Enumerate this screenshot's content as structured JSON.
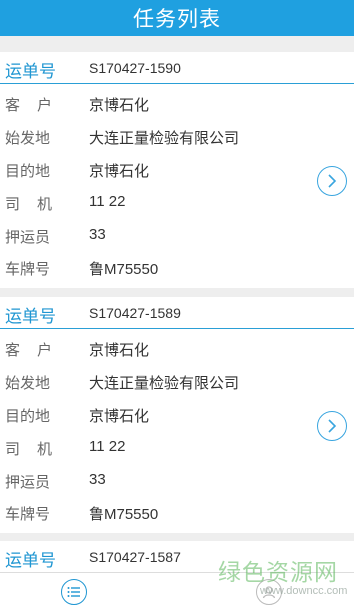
{
  "header": {
    "title": "任务列表"
  },
  "tasks": [
    {
      "waybill_label": "运单号",
      "waybill_no": "S170427-1590",
      "fields": [
        {
          "label": "客户",
          "value": "京博石化"
        },
        {
          "label": "始发地",
          "value": "大连正量检验有限公司"
        },
        {
          "label": "目的地",
          "value": "京博石化"
        },
        {
          "label": "司机",
          "value": "11 22"
        },
        {
          "label": "押运员",
          "value": "33"
        },
        {
          "label": "车牌号",
          "value": "鲁M75550"
        }
      ]
    },
    {
      "waybill_label": "运单号",
      "waybill_no": "S170427-1589",
      "fields": [
        {
          "label": "客户",
          "value": "京博石化"
        },
        {
          "label": "始发地",
          "value": "大连正量检验有限公司"
        },
        {
          "label": "目的地",
          "value": "京博石化"
        },
        {
          "label": "司机",
          "value": "11 22"
        },
        {
          "label": "押运员",
          "value": "33"
        },
        {
          "label": "车牌号",
          "value": "鲁M75550"
        }
      ]
    },
    {
      "waybill_label": "运单号",
      "waybill_no": "S170427-1587"
    }
  ],
  "bottom_nav": {
    "items": [
      {
        "icon": "list-icon"
      },
      {
        "icon": "user-icon"
      }
    ]
  },
  "watermark": {
    "main": "绿色资源网",
    "sub": "www.downcc.com"
  },
  "colors": {
    "header_bg": "#1fa0e0",
    "accent": "#1f96d2",
    "label_text": "#666666",
    "value_text": "#333333"
  }
}
